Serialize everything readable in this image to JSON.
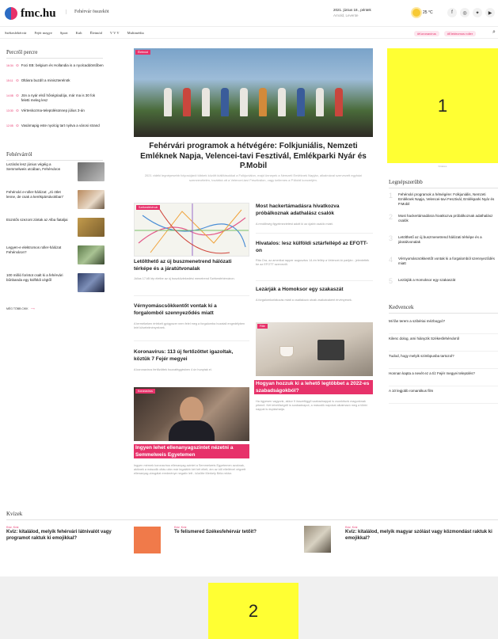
{
  "header": {
    "logo_text": "fmc.hu",
    "tagline": "Fehérvár összeköt",
    "date": "2021. június 18., péntek",
    "nameday": "Arnold, Levente",
    "temperature": "25 °C",
    "social_icons": [
      "facebook-icon",
      "instagram-icon",
      "twitter-icon",
      "youtube-icon",
      "info-icon"
    ]
  },
  "nav": {
    "items": [
      "Székesfehérvár",
      "Fejér megye",
      "Sport",
      "Kult",
      "Életmód",
      "V V V",
      "Multimédia"
    ],
    "pills": [
      "#Koronavírus",
      "#Elektromos roller"
    ],
    "search_icon": "search-icon"
  },
  "perc": {
    "title": "Percről percre",
    "items": [
      {
        "time": "16:34",
        "text": "Foci EB: belgium és Hollandia is a nyolcaddöntőben"
      },
      {
        "time": "15:11",
        "text": "Oltásra buzdít a miniszterelnök"
      },
      {
        "time": "14:08",
        "text": "Jön a nyár első hőségriadója, már ma is 30 fok feletti meleg lesz"
      },
      {
        "time": "13:30",
        "text": "Vérteskozma-településünnep július 3-án"
      },
      {
        "time": "12:05",
        "text": "Vasárnapig este nyolcig tart nyitva a városi strand"
      }
    ]
  },
  "fehervarrol": {
    "title": "Fehérvárról",
    "items": [
      {
        "text": "Lezárás lesz június végéig a Semmelweis utcában, Fehérváron"
      },
      {
        "text": "Fehérvári e-roller-hálózat: „Jó ötlet lenne, de csak a kerékpársávokban”"
      },
      {
        "text": "Eüzstős szezont zártak az Alba fiataljai"
      },
      {
        "text": "Legyen-e elektromos roller-hálózat Fehérváron?"
      },
      {
        "text": "100 millió forintot csalt ki a fehérvári bűnbanda egy külföldi cégtől"
      }
    ],
    "more_label": "MÉG TÖBB CIKK",
    "more_icon": "arrow-right-icon"
  },
  "hero": {
    "tag": "Életmód",
    "title": "Fehérvári programok a hétvégére: Folkjuniális, Nemzeti Emléknek Napja, Velencei-tavi Fesztivál, Emlékparki Nyár és P.Mobil",
    "lead": "2021 vidéki legnépesebb folyosójáról többek között kiállításokkal a Folkjuniálon, majd ünnepek a Nemzeti Emléknek Napján, alkalmával szervezett egyházi szemrevételén, továbbá ott a Velencei-tavi Fesztiválon, vagy kellemes a P.Mobil koncertjén."
  },
  "col_a": {
    "map_tag": "Székesfehérvár",
    "articles": [
      {
        "title": "Letölthető az új buszmenetrend hálózati térképe és a járatútvonalak",
        "lead": "Július 17-től lép életbe az új buszközlekedési menetrend Székesfehérváron."
      },
      {
        "title": "Vérnyomáscsökkentőt vontak ki a forgalomból szennyeződés miatt",
        "lead": "A termékeken értékelt gyógyszer nem felel meg a forgalomba hozatali engedélyben leírt követelményeknek."
      },
      {
        "title": "Koronavírus: 113 új fertőzöttet igazoltak, köztük 7 Fejér megyei",
        "lead": "A koronavírus fertőzöttek hozzaféggésben 4 ún hunytak el."
      }
    ],
    "doc_tag": "Koronavírus",
    "doc_title": "Ingyen lehet ellenanyagszintet nézetni a Semmelweis Egyetemen",
    "doc_lead": "Ingyen mérnek koronavírus ellenanyag-szintet a Semmelweis Egyetemen azoknak, akiknek a második oltás után már legalább két hét eltelt, ám az idő elteltével végzett ellenanyag-vizsgálat eredménye negatív lett - közölte Merkely Béla rektor."
  },
  "col_b": {
    "articles": [
      {
        "title": "Most hackertámadásra hivatkozva próbálkoznak adathalász csalók",
        "lead": "A rendőrség figyelmeztetést adott ki az újabb csalók miatt."
      },
      {
        "title": "Hivatalos: lesz külföldi sztárfellépő az EFOTT-on",
        "lead": "Rita Ora, az amerikai rapper augusztus 14-én fellép a Velencei-tó partján - jelentették be az EFOTT szervezői."
      },
      {
        "title": "Lezárják a Homoksor egy szakaszát",
        "lead": "A forgalomkorlátozás miatt a csatlakozó utcák zsákutcaként érvényesek."
      }
    ],
    "desk_tag": "Fitte",
    "desk_title": "Hogyan hozzuk ki a lehető legtöbbet a 2022-es szabadságokból?",
    "desk_lead": "Ha ügyesen vagyunk, akkor 9 összefüggő szabadnappal is csonkítunk magunknak pihenő. Két lehetőségről is szabadnapot, a második napokat alkalmazó meg a többi nappal is duplázhatja."
  },
  "sidebar": {
    "ad1_label": "1",
    "ad1_caption": "hirdetés",
    "lep_title": "Legnépszerűbb",
    "lep_items": [
      {
        "n": "1",
        "text": "Fehérvári programok a hétvégére: Folkjuniális, Nemzeti Emléknek Napja, Velencei-tavi Fesztivál, Emlékparki Nyár és P.Mobil"
      },
      {
        "n": "2",
        "text": "Most hackertámadásra hivatkozva próbálkoznak adathalász csalók"
      },
      {
        "n": "3",
        "text": "Letölthető az új buszmenetrend hálózati térképe és a járatútvonalak"
      },
      {
        "n": "4",
        "text": "Vérnyomáscsökkentőt vontak ki a forgalomból szennyeződés miatt"
      },
      {
        "n": "5",
        "text": "Lezárják a Homoksor egy szakaszát"
      }
    ],
    "ked_title": "Kedvencek",
    "ked_items": [
      "Mi fán terem a szibériai mézbogyó?",
      "Kilenc dolog, ami hiányzik Székesfehérvárról",
      "Tudod, hogy melyik szimbpusba tartozol?",
      "Honnan kapta a nevét ez a tíz Fejér megyei település?",
      "A 10 legjobb romantikus film"
    ]
  },
  "quiz": {
    "title": "Kvízek",
    "items": [
      {
        "kat": "Kvíz, Kvíz",
        "title": "Kvíz: kitalálod, melyik fehérvári látnivalót vagy programot raktuk ki emojikkal?"
      },
      {
        "kat": "Kvíz, Kvíz",
        "title": "Te felismered Székesfehérvár tetőit?"
      },
      {
        "kat": "Kvíz, Kvíz",
        "title": "Kvíz: kitalálod, melyik magyar szólást vagy közmondást raktuk ki emojikkal?"
      }
    ]
  },
  "ad2_label": "2",
  "colors": {
    "accent": "#e7326a",
    "ad": "#ffff33"
  }
}
